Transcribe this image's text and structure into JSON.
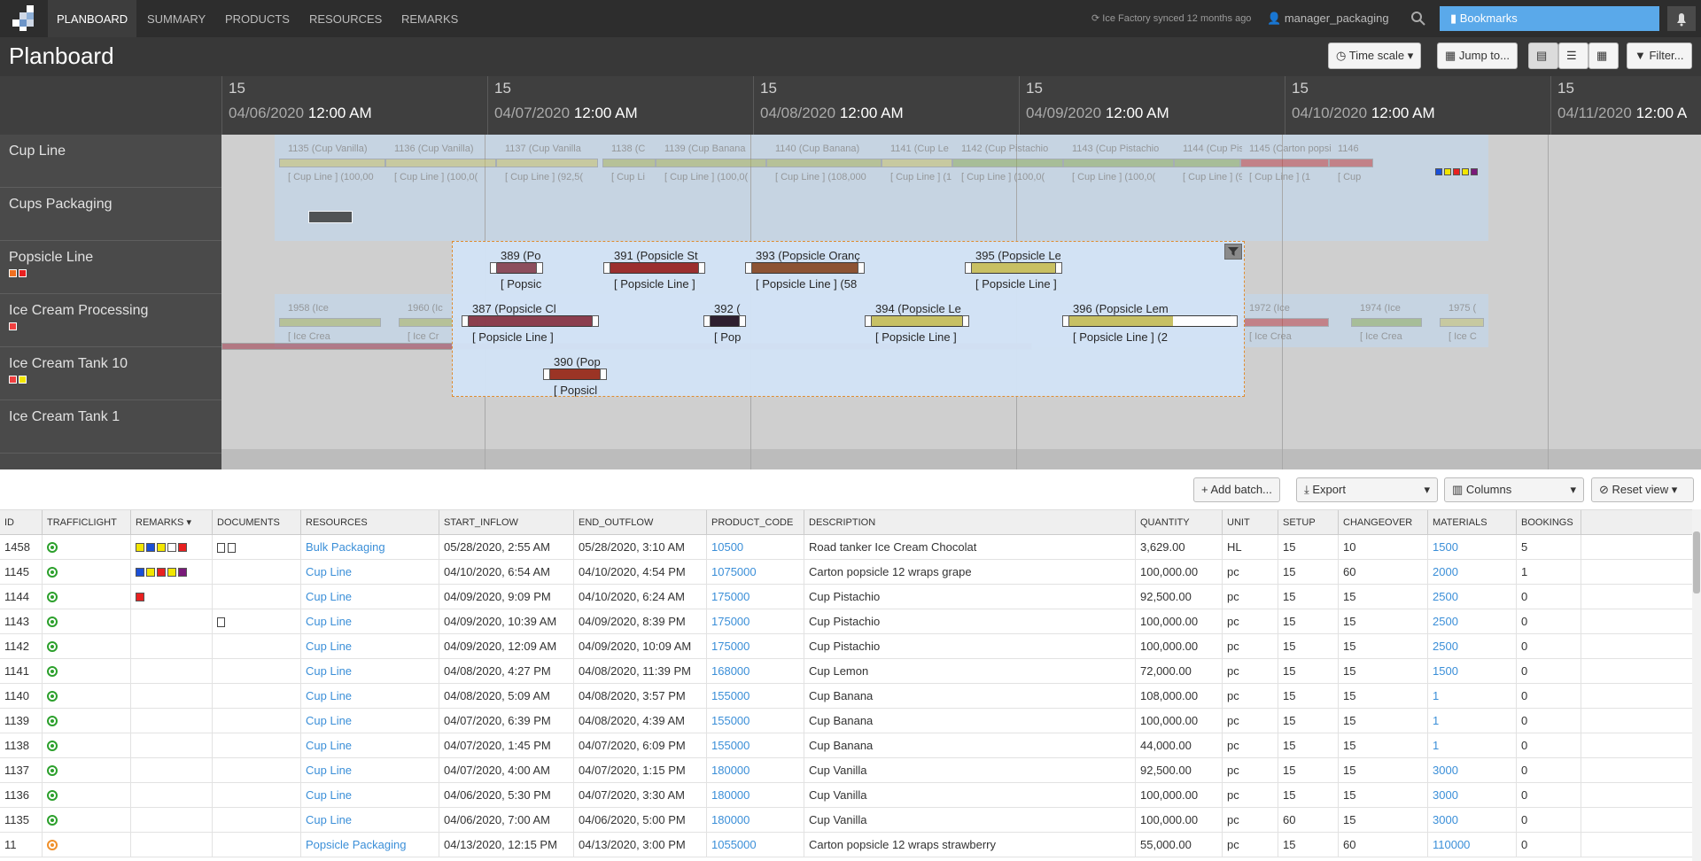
{
  "nav": {
    "tabs": [
      "PLANBOARD",
      "SUMMARY",
      "PRODUCTS",
      "RESOURCES",
      "REMARKS"
    ],
    "sync_text": "Ice Factory synced 12 months ago",
    "user": "manager_packaging",
    "bookmarks_label": "Bookmarks"
  },
  "titlebar": {
    "title": "Planboard",
    "timescale_label": "Time scale",
    "jumpto_label": "Jump to...",
    "filter_label": "Filter..."
  },
  "timeline": [
    {
      "day": "15",
      "date": "04/06/2020",
      "time": "12:00 AM"
    },
    {
      "day": "15",
      "date": "04/07/2020",
      "time": "12:00 AM"
    },
    {
      "day": "15",
      "date": "04/08/2020",
      "time": "12:00 AM"
    },
    {
      "day": "15",
      "date": "04/09/2020",
      "time": "12:00 AM"
    },
    {
      "day": "15",
      "date": "04/10/2020",
      "time": "12:00 AM"
    },
    {
      "day": "15",
      "date": "04/11/2020",
      "time": "12:00 A"
    }
  ],
  "resources": [
    {
      "name": "Cup Line"
    },
    {
      "name": "Cups Packaging"
    },
    {
      "name": "Popsicle Line"
    },
    {
      "name": "Ice Cream Processing"
    },
    {
      "name": "Ice Cream Tank 10"
    },
    {
      "name": "Ice Cream Tank 1"
    }
  ],
  "cupline_bars": [
    {
      "title": "1135 (Cup Vanilla)",
      "sub": "[ Cup Line ] (100,00"
    },
    {
      "title": "1136 (Cup Vanilla)",
      "sub": "[ Cup Line ] (100,0("
    },
    {
      "title": "1137 (Cup Vanilla",
      "sub": "[ Cup Line ] (92,5("
    },
    {
      "title": "1138 (C",
      "sub": "[ Cup Li"
    },
    {
      "title": "1139 (Cup Banana",
      "sub": "[ Cup Line ] (100,0("
    },
    {
      "title": "1140 (Cup Banana)",
      "sub": "[ Cup Line ] (108,000"
    },
    {
      "title": "1141 (Cup Le",
      "sub": "[ Cup Line ] (1"
    },
    {
      "title": "1142 (Cup Pistachio",
      "sub": "[ Cup Line ] (100,0("
    },
    {
      "title": "1143 (Cup Pistachio",
      "sub": "[ Cup Line ] (100,0("
    },
    {
      "title": "1144 (Cup Pistach",
      "sub": "[ Cup Line ] (92,5"
    },
    {
      "title": "1145 (Carton popsic",
      "sub": "[ Cup Line ] (1"
    },
    {
      "title": "1146",
      "sub": "[ Cup"
    }
  ],
  "icp_bars": [
    {
      "title": "1958 (Ice",
      "sub": "[ Ice Crea"
    },
    {
      "title": "1960 (Ic",
      "sub": "[ Ice Cr"
    },
    {
      "title": "1972 (Ice",
      "sub": "[ Ice Crea"
    },
    {
      "title": "1974 (Ice",
      "sub": "[ Ice Crea"
    },
    {
      "title": "1975 (",
      "sub": "[ Ice C"
    }
  ],
  "overlay_bars": [
    {
      "title": "389 (Po",
      "sub": "[ Popsic",
      "color": "#8a4a5a"
    },
    {
      "title": "391 (Popsicle St",
      "sub": "[ Popsicle Line ]",
      "color": "#9a2a2a"
    },
    {
      "title": "393 (Popsicle Oranç",
      "sub": "[ Popsicle Line ] (58",
      "color": "#8a5030"
    },
    {
      "title": "395 (Popsicle Le",
      "sub": "[ Popsicle Line ]",
      "color": "#c8c060"
    },
    {
      "title": "387 (Popsicle Cl",
      "sub": "[ Popsicle Line ]",
      "color": "#8a3a4a"
    },
    {
      "title": "392 (",
      "sub": "[ Pop",
      "color": "#2a1a2a"
    },
    {
      "title": "394 (Popsicle Le",
      "sub": "[ Popsicle Line ]",
      "color": "#c8c060"
    },
    {
      "title": "396 (Popsicle Lem",
      "sub": "[ Popsicle Line ] (2",
      "color": "#c8c060"
    },
    {
      "title": "390 (Pop",
      "sub": "[ Popsicl",
      "color": "#9a3020"
    }
  ],
  "tabletool": {
    "add_batch": "Add batch...",
    "export": "Export",
    "columns": "Columns",
    "reset_view": "Reset view"
  },
  "table": {
    "headers": [
      "ID",
      "TRAFFICLIGHT",
      "REMARKS",
      "DOCUMENTS",
      "RESOURCES",
      "START_INFLOW",
      "END_OUTFLOW",
      "PRODUCT_CODE",
      "DESCRIPTION",
      "QUANTITY",
      "UNIT",
      "SETUP",
      "CHANGEOVER",
      "MATERIALS",
      "BOOKINGS"
    ],
    "rows": [
      {
        "id": "1458",
        "light": "green",
        "remarks": [
          "#f2e600",
          "#1a4fd8",
          "#f2e600",
          "#ffffff",
          "#e82020"
        ],
        "docs": 2,
        "resource": "Bulk Packaging",
        "start": "05/28/2020, 2:55 AM",
        "end": "05/28/2020, 3:10 AM",
        "code": "10500",
        "desc": "Road tanker Ice Cream Chocolat",
        "qty": "3,629.00",
        "unit": "HL",
        "setup": "15",
        "change": "10",
        "mat": "1500",
        "book": "5"
      },
      {
        "id": "1145",
        "light": "green",
        "remarks": [
          "#1a4fd8",
          "#f2e600",
          "#e82020",
          "#f2e600",
          "#7a1a7a"
        ],
        "docs": 0,
        "resource": "Cup Line",
        "start": "04/10/2020, 6:54 AM",
        "end": "04/10/2020, 4:54 PM",
        "code": "1075000",
        "desc": "Carton popsicle 12 wraps grape",
        "qty": "100,000.00",
        "unit": "pc",
        "setup": "15",
        "change": "60",
        "mat": "2000",
        "book": "1"
      },
      {
        "id": "1144",
        "light": "green",
        "remarks": [
          "#e82020"
        ],
        "docs": 0,
        "resource": "Cup Line",
        "start": "04/09/2020, 9:09 PM",
        "end": "04/10/2020, 6:24 AM",
        "code": "175000",
        "desc": "Cup Pistachio",
        "qty": "92,500.00",
        "unit": "pc",
        "setup": "15",
        "change": "15",
        "mat": "2500",
        "book": "0"
      },
      {
        "id": "1143",
        "light": "green",
        "remarks": [],
        "docs": 1,
        "resource": "Cup Line",
        "start": "04/09/2020, 10:39 AM",
        "end": "04/09/2020, 8:39 PM",
        "code": "175000",
        "desc": "Cup Pistachio",
        "qty": "100,000.00",
        "unit": "pc",
        "setup": "15",
        "change": "15",
        "mat": "2500",
        "book": "0"
      },
      {
        "id": "1142",
        "light": "green",
        "remarks": [],
        "docs": 0,
        "resource": "Cup Line",
        "start": "04/09/2020, 12:09 AM",
        "end": "04/09/2020, 10:09 AM",
        "code": "175000",
        "desc": "Cup Pistachio",
        "qty": "100,000.00",
        "unit": "pc",
        "setup": "15",
        "change": "15",
        "mat": "2500",
        "book": "0"
      },
      {
        "id": "1141",
        "light": "green",
        "remarks": [],
        "docs": 0,
        "resource": "Cup Line",
        "start": "04/08/2020, 4:27 PM",
        "end": "04/08/2020, 11:39 PM",
        "code": "168000",
        "desc": "Cup Lemon",
        "qty": "72,000.00",
        "unit": "pc",
        "setup": "15",
        "change": "15",
        "mat": "1500",
        "book": "0"
      },
      {
        "id": "1140",
        "light": "green",
        "remarks": [],
        "docs": 0,
        "resource": "Cup Line",
        "start": "04/08/2020, 5:09 AM",
        "end": "04/08/2020, 3:57 PM",
        "code": "155000",
        "desc": "Cup Banana",
        "qty": "108,000.00",
        "unit": "pc",
        "setup": "15",
        "change": "15",
        "mat": "1",
        "book": "0"
      },
      {
        "id": "1139",
        "light": "green",
        "remarks": [],
        "docs": 0,
        "resource": "Cup Line",
        "start": "04/07/2020, 6:39 PM",
        "end": "04/08/2020, 4:39 AM",
        "code": "155000",
        "desc": "Cup Banana",
        "qty": "100,000.00",
        "unit": "pc",
        "setup": "15",
        "change": "15",
        "mat": "1",
        "book": "0"
      },
      {
        "id": "1138",
        "light": "green",
        "remarks": [],
        "docs": 0,
        "resource": "Cup Line",
        "start": "04/07/2020, 1:45 PM",
        "end": "04/07/2020, 6:09 PM",
        "code": "155000",
        "desc": "Cup Banana",
        "qty": "44,000.00",
        "unit": "pc",
        "setup": "15",
        "change": "15",
        "mat": "1",
        "book": "0"
      },
      {
        "id": "1137",
        "light": "green",
        "remarks": [],
        "docs": 0,
        "resource": "Cup Line",
        "start": "04/07/2020, 4:00 AM",
        "end": "04/07/2020, 1:15 PM",
        "code": "180000",
        "desc": "Cup Vanilla",
        "qty": "92,500.00",
        "unit": "pc",
        "setup": "15",
        "change": "15",
        "mat": "3000",
        "book": "0"
      },
      {
        "id": "1136",
        "light": "green",
        "remarks": [],
        "docs": 0,
        "resource": "Cup Line",
        "start": "04/06/2020, 5:30 PM",
        "end": "04/07/2020, 3:30 AM",
        "code": "180000",
        "desc": "Cup Vanilla",
        "qty": "100,000.00",
        "unit": "pc",
        "setup": "15",
        "change": "15",
        "mat": "3000",
        "book": "0"
      },
      {
        "id": "1135",
        "light": "green",
        "remarks": [],
        "docs": 0,
        "resource": "Cup Line",
        "start": "04/06/2020, 7:00 AM",
        "end": "04/06/2020, 5:00 PM",
        "code": "180000",
        "desc": "Cup Vanilla",
        "qty": "100,000.00",
        "unit": "pc",
        "setup": "60",
        "change": "15",
        "mat": "3000",
        "book": "0"
      },
      {
        "id": "11",
        "light": "orange",
        "remarks": [],
        "docs": 0,
        "resource": "Popsicle Packaging",
        "start": "04/13/2020, 12:15 PM",
        "end": "04/13/2020, 3:00 PM",
        "code": "1055000",
        "desc": "Carton popsicle 12 wraps strawberry",
        "qty": "55,000.00",
        "unit": "pc",
        "setup": "15",
        "change": "60",
        "mat": "110000",
        "book": "0"
      }
    ]
  }
}
